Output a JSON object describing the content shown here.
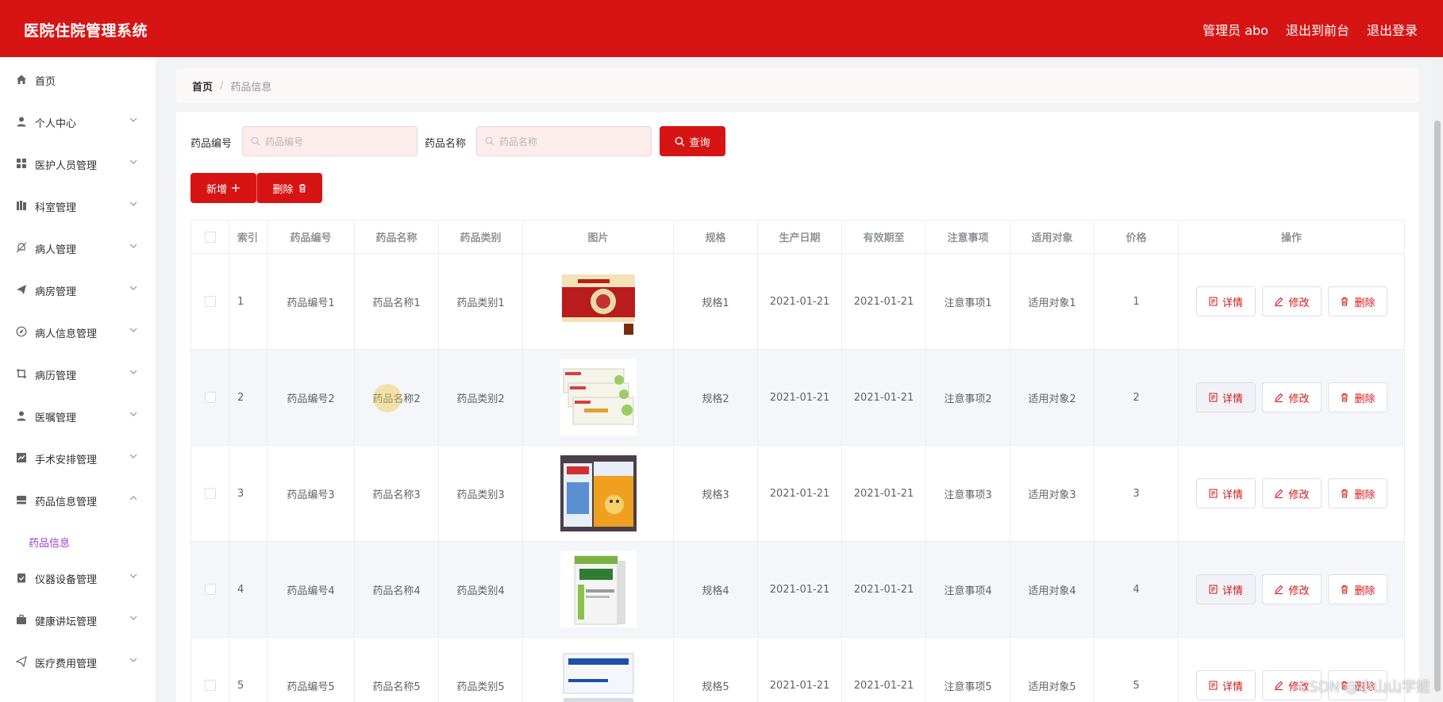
{
  "header": {
    "app_title": "医院住院管理系统",
    "user": "管理员 abo",
    "to_front": "退出到前台",
    "logout": "退出登录"
  },
  "sidebar": {
    "items": [
      {
        "label": "首页",
        "icon": "home-icon"
      },
      {
        "label": "个人中心",
        "icon": "user-icon"
      },
      {
        "label": "医护人员管理",
        "icon": "grid-icon"
      },
      {
        "label": "科室管理",
        "icon": "books-icon"
      },
      {
        "label": "病人管理",
        "icon": "no-bell-icon"
      },
      {
        "label": "病房管理",
        "icon": "send-icon"
      },
      {
        "label": "病人信息管理",
        "icon": "compass-icon"
      },
      {
        "label": "病历管理",
        "icon": "crop-icon"
      },
      {
        "label": "医嘱管理",
        "icon": "user-icon"
      },
      {
        "label": "手术安排管理",
        "icon": "chart-icon"
      },
      {
        "label": "药品信息管理",
        "icon": "stack-icon"
      },
      {
        "label": "仪器设备管理",
        "icon": "clipboard-check-icon"
      },
      {
        "label": "健康讲坛管理",
        "icon": "briefcase-icon"
      },
      {
        "label": "医疗费用管理",
        "icon": "send-icon"
      }
    ],
    "active_sub": "药品信息"
  },
  "breadcrumb": {
    "home": "首页",
    "separator": "/",
    "current": "药品信息"
  },
  "search": {
    "code_label": "药品编号",
    "code_placeholder": "药品编号",
    "name_label": "药品名称",
    "name_placeholder": "药品名称",
    "query_button": "查询"
  },
  "actions": {
    "add": "新增",
    "delete": "删除"
  },
  "table": {
    "columns": [
      "索引",
      "药品编号",
      "药品名称",
      "药品类别",
      "图片",
      "规格",
      "生产日期",
      "有效期至",
      "注意事项",
      "适用对象",
      "价格",
      "操作"
    ],
    "rows": [
      {
        "index": "1",
        "code": "药品编号1",
        "name": "药品名称1",
        "category": "药品类别1",
        "spec": "规格1",
        "made": "2021-01-21",
        "expire": "2021-01-21",
        "note": "注意事项1",
        "target": "适用对象1",
        "price": "1"
      },
      {
        "index": "2",
        "code": "药品编号2",
        "name": "药品名称2",
        "category": "药品类别2",
        "spec": "规格2",
        "made": "2021-01-21",
        "expire": "2021-01-21",
        "note": "注意事项2",
        "target": "适用对象2",
        "price": "2"
      },
      {
        "index": "3",
        "code": "药品编号3",
        "name": "药品名称3",
        "category": "药品类别3",
        "spec": "规格3",
        "made": "2021-01-21",
        "expire": "2021-01-21",
        "note": "注意事项3",
        "target": "适用对象3",
        "price": "3"
      },
      {
        "index": "4",
        "code": "药品编号4",
        "name": "药品名称4",
        "category": "药品类别4",
        "spec": "规格4",
        "made": "2021-01-21",
        "expire": "2021-01-21",
        "note": "注意事项4",
        "target": "适用对象4",
        "price": "4"
      },
      {
        "index": "5",
        "code": "药品编号5",
        "name": "药品名称5",
        "category": "药品类别5",
        "spec": "规格5",
        "made": "2021-01-21",
        "expire": "2021-01-21",
        "note": "注意事项5",
        "target": "适用对象5",
        "price": "5"
      }
    ],
    "op_detail": "详情",
    "op_edit": "修改",
    "op_delete": "删除"
  },
  "watermark": "CSDN @小山山学姐",
  "colors": {
    "brand": "#d71414",
    "active_submenu": "#9b3fd0"
  }
}
